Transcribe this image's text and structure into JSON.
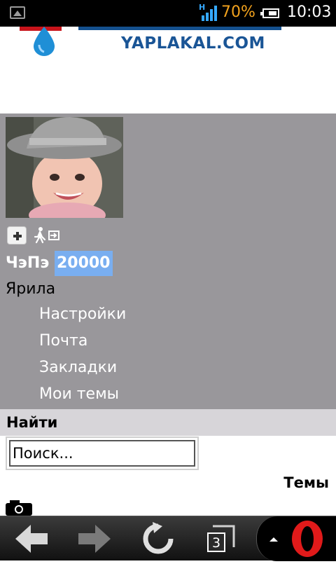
{
  "status_bar": {
    "network": "H",
    "battery_percent": "70%",
    "battery_level": 0.7,
    "time": "10:03",
    "icons": [
      "image-notification-icon",
      "signal-icon",
      "battery-icon"
    ]
  },
  "logo": {
    "text": "YAPLAKAL.COM"
  },
  "profile": {
    "username": "ЧэПэ",
    "points": "20000",
    "rank": "Ярила",
    "menu": [
      {
        "label": "Настройки"
      },
      {
        "label": "Почта"
      },
      {
        "label": "Закладки"
      },
      {
        "label": "Мои темы"
      }
    ]
  },
  "find": {
    "title": "Найти",
    "search_placeholder": "Поиск..."
  },
  "topics_label": "Темы",
  "bottom_nav": {
    "tabs_count": "3",
    "icons": [
      "back-arrow-icon",
      "forward-arrow-icon",
      "reload-icon",
      "tabs-icon",
      "opera-menu-icon"
    ]
  },
  "colors": {
    "profile_bg": "#99979b",
    "points_highlight": "#79aef0",
    "find_bar_bg": "#d7d5d9",
    "battery_text": "#f2a21d",
    "logo_blue": "#1a5596",
    "opera_red": "#e01a1a"
  }
}
